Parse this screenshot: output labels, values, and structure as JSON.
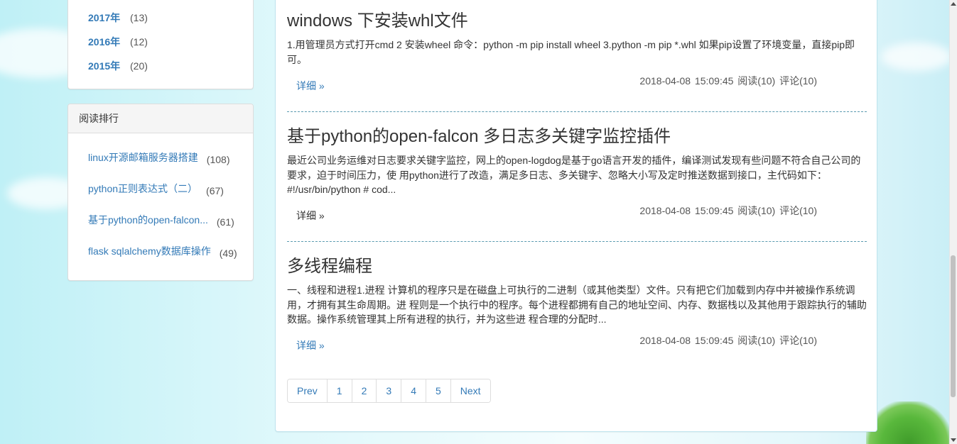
{
  "archive": {
    "items": [
      {
        "year": "2017年",
        "count": "(13)"
      },
      {
        "year": "2016年",
        "count": "(12)"
      },
      {
        "year": "2015年",
        "count": "(20)"
      }
    ]
  },
  "rank": {
    "heading": "阅读排行",
    "items": [
      {
        "title": "linux开源邮箱服务器搭建",
        "count": "(108)"
      },
      {
        "title": "python正则表达式（二）",
        "count": "(67)"
      },
      {
        "title": "基于python的open-falcon...",
        "count": "(61)"
      },
      {
        "title": "flask sqlalchemy数据库操作",
        "count": "(49)"
      }
    ]
  },
  "posts": [
    {
      "title": "windows 下安装whl文件",
      "excerpt": "1.用管理员方式打开cmd 2 安装wheel 命令：python -m pip install wheel 3.python -m pip *.whl 如果pip设置了环境变量，直接pip即可。",
      "meta": "2018-04-08 15:09:45  阅读(10)  评论(10)",
      "detail": "详细 »"
    },
    {
      "title": "基于python的open-falcon 多日志多关键字监控插件",
      "excerpt": "最近公司业务运维对日志要求关键字监控，网上的open-logdog是基于go语言开发的插件，编译测试发现有些问题不符合自己公司的要求，迫于时间压力，使 用python进行了改造，满足多日志、多关键字、忽略大小写及定时推送数据到接口，主代码如下：#!/usr/bin/python # cod...",
      "meta": "2018-04-08 15:09:45  阅读(10)  评论(10)",
      "detail": "详细 »"
    },
    {
      "title": "多线程编程",
      "excerpt": "一、线程和进程1.进程 计算机的程序只是在磁盘上可执行的二进制（或其他类型）文件。只有把它们加载到内存中并被操作系统调用，才拥有其生命周期。进 程则是一个执行中的程序。每个进程都拥有自己的地址空间、内存、数据栈以及其他用于跟踪执行的辅助数据。操作系统管理其上所有进程的执行，并为这些进 程合理的分配时...",
      "meta": "2018-04-08 15:09:45  阅读(10)  评论(10)",
      "detail": "详细 »"
    }
  ],
  "pagination": {
    "prev": "Prev",
    "pages": [
      "1",
      "2",
      "3",
      "4",
      "5"
    ],
    "next": "Next"
  },
  "colors": {
    "link": "#337ab7",
    "divider": "#5a9ab0"
  }
}
